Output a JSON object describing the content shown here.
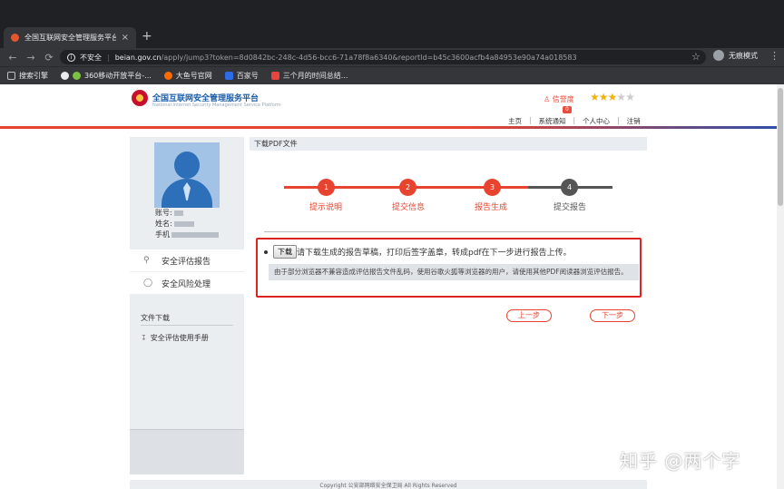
{
  "browser": {
    "tab_title": "全国互联网安全管理服务平台",
    "tab_close": "×",
    "new_tab": "+",
    "nav_back": "←",
    "nav_forward": "→",
    "nav_reload": "⟳",
    "security_label": "不安全",
    "url_host": "beian.gov.cn",
    "url_rest": "/apply/jump3?token=8d0842bc-248c-4d56-bcc6-71a78f8a6340&reportId=b45c3600acfb4a84953e90a74a018583",
    "incognito_label": "无痕模式",
    "bookmarks": [
      "搜索引擎",
      "360移动开放平台-...",
      "大鱼号官网",
      "百家号",
      "三个月的时间总结..."
    ]
  },
  "site": {
    "title": "全国互联网安全管理服务平台",
    "subtitle": "National Internet Security Management Service Platform",
    "credit_label": "信誉度",
    "credit_count": "0",
    "rating_stars": 3,
    "rating_max": 5,
    "nav": [
      "主页",
      "系统通知",
      "个人中心",
      "注销"
    ]
  },
  "sidebar": {
    "account_label": "账号:",
    "name_label": "姓名:",
    "phone_label": "手机",
    "menu": [
      {
        "icon": "search-icon",
        "label": "安全评估报告"
      },
      {
        "icon": "shield-icon",
        "label": "安全风险处理"
      }
    ],
    "files_title": "文件下载",
    "file_link": "安全评估使用手册"
  },
  "main": {
    "panel_title": "下载PDF文件",
    "steps": [
      {
        "num": "1",
        "label": "提示说明",
        "done": true
      },
      {
        "num": "2",
        "label": "提交信息",
        "done": true
      },
      {
        "num": "3",
        "label": "报告生成",
        "done": true
      },
      {
        "num": "4",
        "label": "提交报告",
        "done": false
      }
    ],
    "download_button": "下载",
    "instruction": "请下载生成的报告草稿，打印后签字盖章，转成pdf在下一步进行报告上传。",
    "tip": "由于部分浏览器不兼容造成评估报告文件乱码，使用谷歌火狐等浏览器的用户，请使用其他PDF阅读器浏览评估报告。",
    "prev_button": "上一步",
    "next_button": "下一步"
  },
  "footer": {
    "text": "Copyright 公安部网络安全保卫局 All Rights Reserved"
  },
  "watermark": "知乎 @两个字",
  "colors": {
    "accent_red": "#e8432e",
    "step_done": "#e8432e",
    "step_pending": "#555555",
    "brand_blue": "#1d5fa9"
  }
}
